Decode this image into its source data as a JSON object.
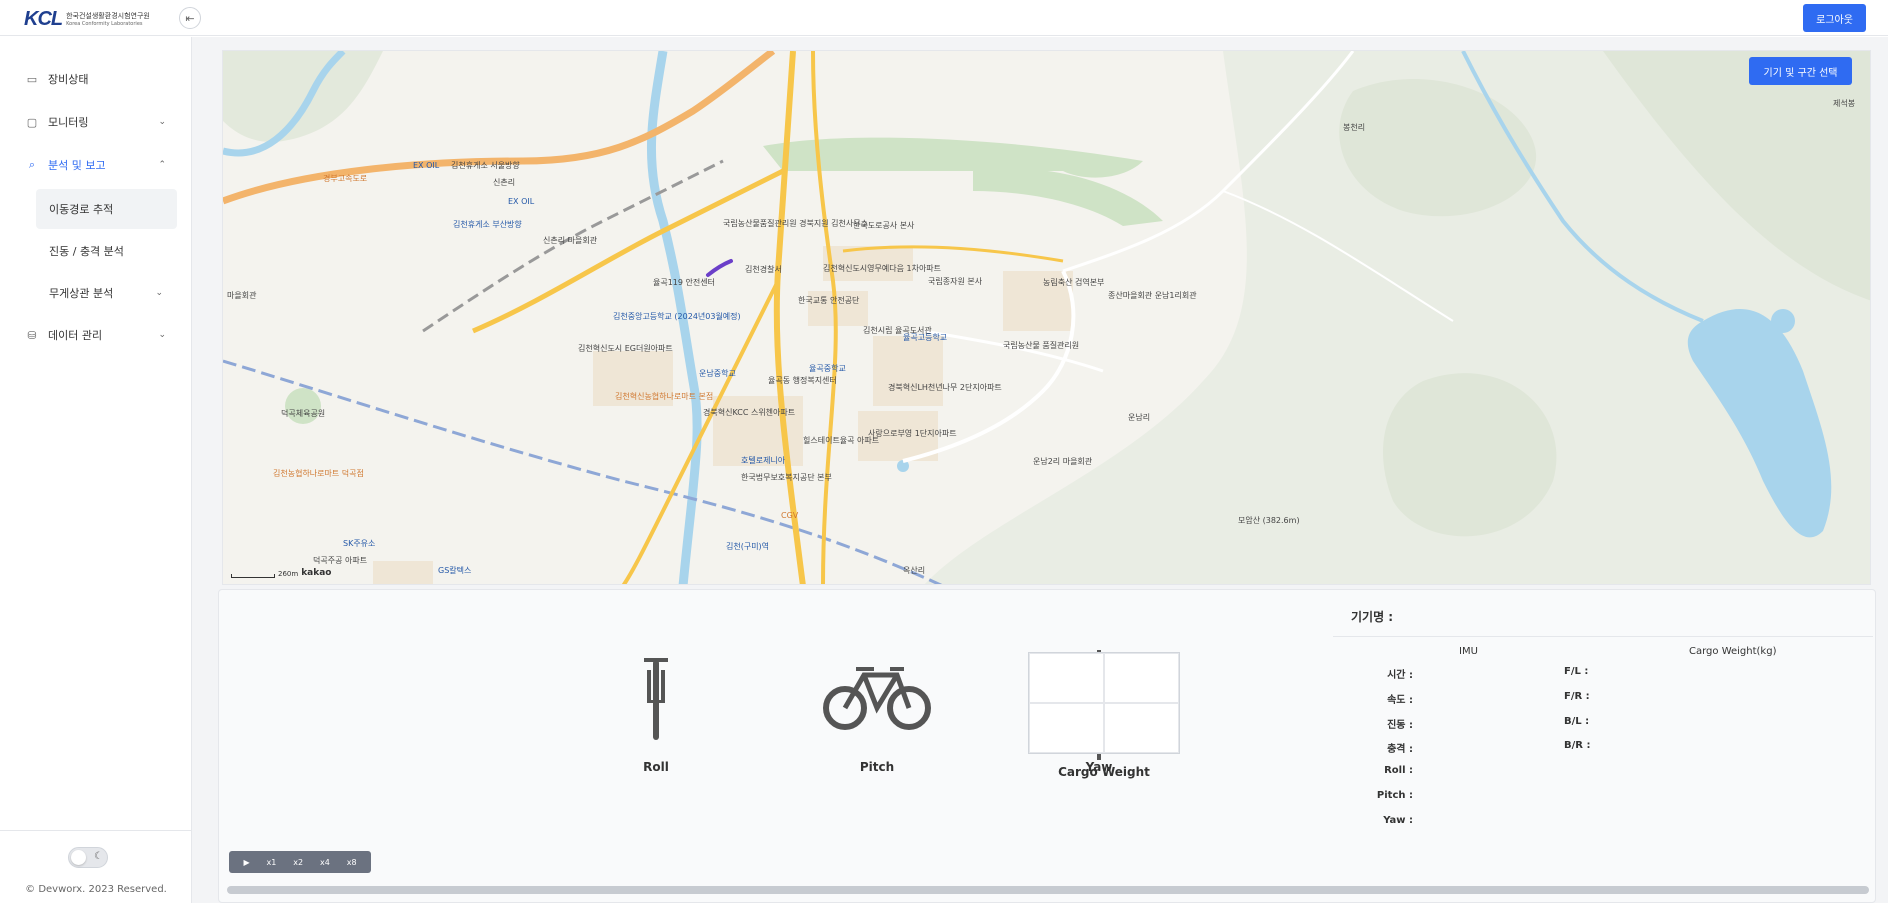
{
  "header": {
    "logo_mark": "KCL",
    "logo_text_ko": "한국건설생활환경시험연구원",
    "logo_text_en": "Korea Conformity Laboratories",
    "collapse_icon": "⇤",
    "logout_label": "로그아웃"
  },
  "sidebar": {
    "items": [
      {
        "label": "장비상태",
        "icon": "device-icon"
      },
      {
        "label": "모니터링",
        "icon": "monitor-icon"
      },
      {
        "label": "분석 및 보고",
        "icon": "search-icon"
      },
      {
        "label": "데이터 관리",
        "icon": "database-icon"
      }
    ],
    "sub_items": [
      {
        "label": "이동경로 추적"
      },
      {
        "label": "진동 / 충격 분석"
      },
      {
        "label": "무게상관 분석"
      }
    ],
    "copyright": "© Devworx. 2023 Reserved."
  },
  "map": {
    "select_button": "기기 및 구간 선택",
    "scale_label": "260m",
    "provider": "kakao",
    "labels": [
      "김천휴게소 서울방향",
      "EX OIL",
      "EX OIL",
      "신촌리",
      "김천휴게소 부산방향",
      "신촌리 마을회관",
      "경부고속도로",
      "국립농산물품질관리원 경북지원 김천사무소",
      "한국도로공사 본사",
      "김천경찰서",
      "율곡119 안전센터",
      "김천혁신도시영무예다음 1차아파트",
      "국립종자원 본사",
      "농림축산 검역본부",
      "종산마을회관 운남1리회관",
      "한국교통 안전공단",
      "김천중앙고등학교 (2024년03월예정)",
      "김천혁신도시 EG더원아파트",
      "김천시립 율곡도서관",
      "율곡고등학교",
      "국립농산물 품질관리원",
      "율곡중학교",
      "운남중학교",
      "율곡동 행정복지센터",
      "경북혁신LH천년나무 2단지아파트",
      "경북혁신KCC 스위첸아파트",
      "김천혁신농협하나로마트 본점",
      "힐스테이트율곡 아파트",
      "사랑으로부영 1단지아파트",
      "호텔로제니아",
      "한국법무보호복지공단 본부",
      "CGV",
      "김천(구미)역",
      "옥산리",
      "운남리",
      "운남2리 마을회관",
      "봉천리",
      "SK주유소",
      "덕곡주공 아파트",
      "GS칼텍스",
      "덕곡체육공원",
      "마을회관",
      "김천농협하나로마트 덕곡점",
      "모암산 (382.6m)",
      "제석봉"
    ]
  },
  "panel": {
    "sensors": [
      "Roll",
      "Pitch",
      "Yaw",
      "Cargo Weight"
    ],
    "device_label": "기기명 :",
    "imu_header": "IMU",
    "cargo_header": "Cargo Weight(kg)",
    "imu_rows": [
      "시간 :",
      "속도 :",
      "진동 :",
      "충격 :",
      "Roll :",
      "Pitch :",
      "Yaw :"
    ],
    "cargo_rows": [
      "F/L :",
      "F/R :",
      "B/L :",
      "B/R :"
    ],
    "playback": [
      "▶",
      "x1",
      "x2",
      "x4",
      "x8"
    ]
  },
  "colors": {
    "accent": "#2f6bf2",
    "road_major": "#f7c64a",
    "river": "#a8d4ec",
    "route": "#6b3fc9"
  }
}
